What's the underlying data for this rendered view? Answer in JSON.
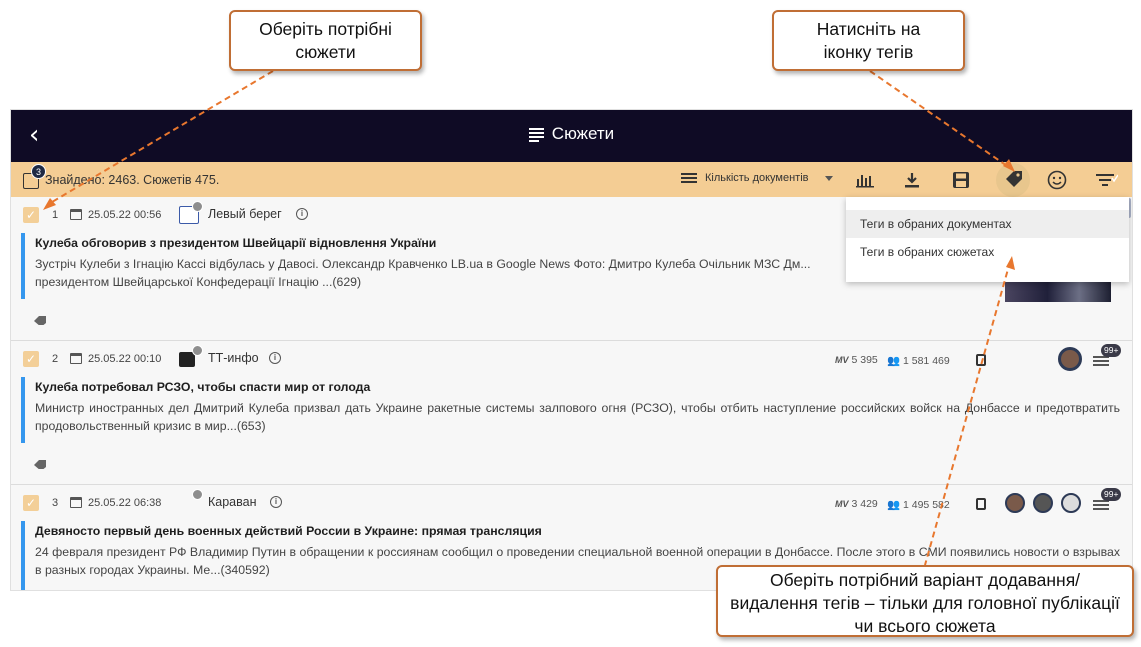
{
  "callouts": {
    "select_stories": "Оберіть потрібні сюжети",
    "click_tags_icon": "Натисніть на іконку тегів",
    "choose_variant": "Оберіть потрібний  варіант додавання/видалення  тегів – тільки для головної публікації чи всього сюжета"
  },
  "app": {
    "back_icon": "chevron-left-icon",
    "title": "Сюжети"
  },
  "toolbar": {
    "selected_count": "3",
    "found_text": "Знайдено: 2463. Сюжетів 475.",
    "sort_label": "Кількість документів",
    "icons": [
      "bar-chart-icon",
      "download-icon",
      "save-icon",
      "tag-icon",
      "smile-icon",
      "filter-icon"
    ]
  },
  "tag_menu": {
    "items": [
      "Теги в обраних документах",
      "Теги в обраних сюжетах"
    ]
  },
  "stories": [
    {
      "index": "1",
      "date": "25.05.22 00:56",
      "source": "Левый берег",
      "headline": "Кулеба обговорив з президентом Швейцарії відновлення України",
      "body": "Зустріч Кулеби з Ігнацію Кассі відбулась у Давосі. Олександр Кравченко LB.ua в Google News Фото: Дмитро Кулеба Очільник МЗС Дм... президентом Швейцарської Конфедерації Ігнацію ...(629)",
      "checked": true
    },
    {
      "index": "2",
      "date": "25.05.22 00:10",
      "source": "ТТ-инфо",
      "headline": "Кулеба потребовал РСЗО, чтобы спасти мир от голода",
      "body": "Министр иностранных дел Дмитрий Кулеба призвал дать Украине ракетные системы залпового огня (РСЗО), чтобы отбить наступление российских войск на Донбассе и предотвратить продовольственный кризис в мир...(653)",
      "views": "5 395",
      "audience": "1 581 469",
      "more_badge": "99+",
      "checked": true
    },
    {
      "index": "3",
      "date": "25.05.22 06:38",
      "source": "Караван",
      "headline": "Девяносто первый день военных действий России в Украине: прямая трансляция",
      "body": "24 февраля президент РФ Владимир Путин в обращении к россиянам сообщил о проведении специальной военной операции в Донбассе. После этого в СМИ появились новости о взрывах в разных городах Украины. Ме...(340592)",
      "views": "3 429",
      "audience": "1 495 582",
      "more_badge": "99+",
      "checked": true
    }
  ],
  "stats_prefix": "MV"
}
